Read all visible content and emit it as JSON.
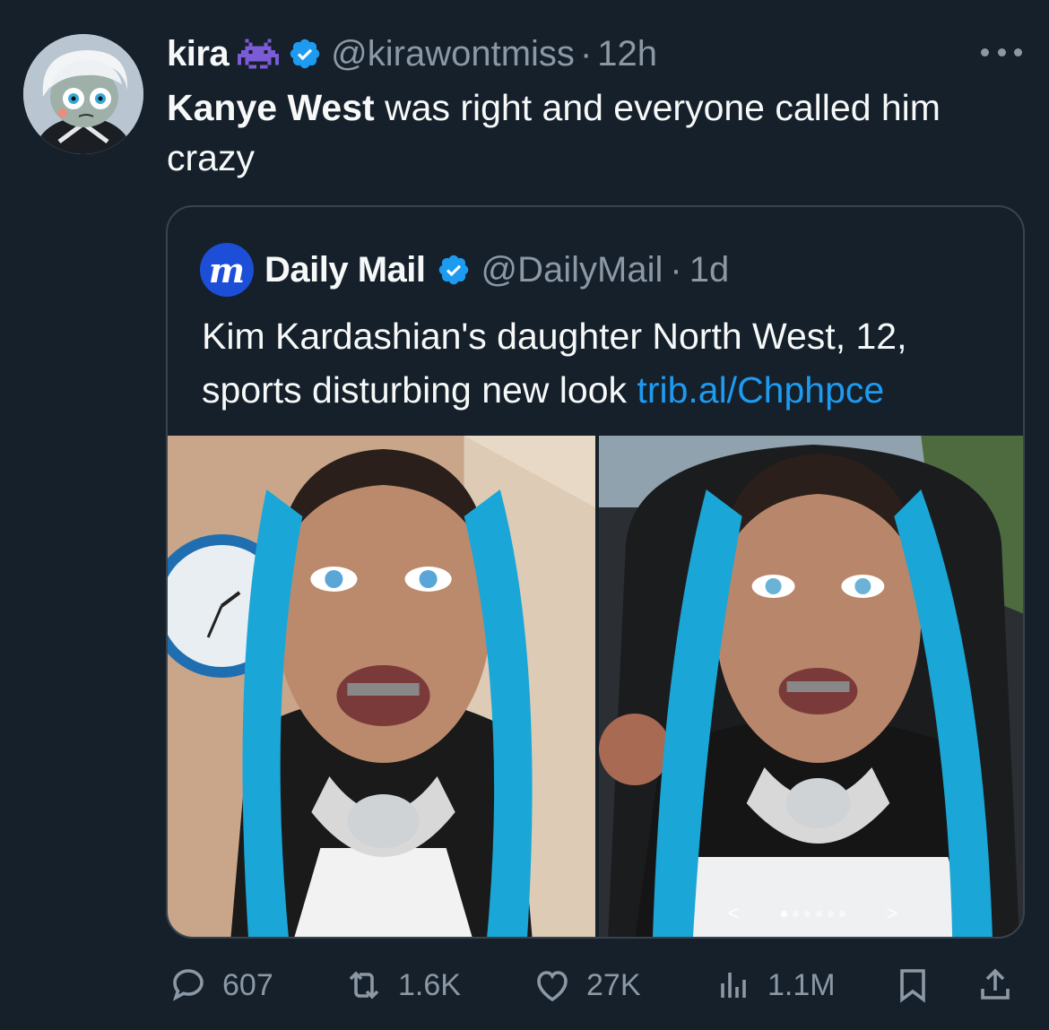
{
  "author": {
    "display_name": "kira",
    "emoji": "alien-monster-emoji",
    "handle": "@kirawontmiss",
    "separator": "·",
    "time": "12h"
  },
  "tweet": {
    "bold": "Kanye West",
    "rest": " was right and everyone called him crazy"
  },
  "quote": {
    "logo_letter": "m",
    "name": "Daily Mail",
    "handle": "@DailyMail",
    "separator": "·",
    "time": "1d",
    "text": "Kim Kardashian's daughter North West, 12, sports disturbing new look ",
    "link": "trib.al/Chphpce",
    "carousel": {
      "prev": "<",
      "next": ">"
    }
  },
  "actions": {
    "replies": "607",
    "reposts": "1.6K",
    "likes": "27K",
    "views": "1.1M"
  },
  "colors": {
    "background": "#15202b",
    "secondary_text": "#8b98a5",
    "link": "#1d9bf0",
    "border": "#38444d",
    "verified": "#1d9bf0"
  }
}
